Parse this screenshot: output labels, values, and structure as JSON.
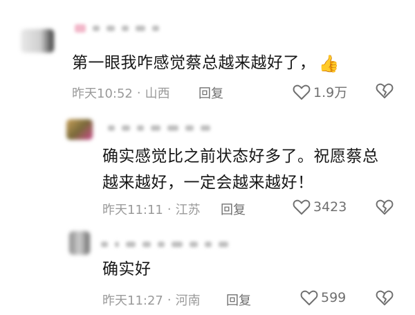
{
  "comments": [
    {
      "text": "第一眼我咋感觉蔡总越来越好了，",
      "emoji": "👍",
      "time": "昨天10:52",
      "location": "山西",
      "reply_label": "回复",
      "likes": "1.9万"
    },
    {
      "text": "确实感觉比之前状态好多了。祝愿蔡总越来越好，一定会越来越好！",
      "line1": "确实感觉比之前状态好多了。祝愿蔡总",
      "line2": "越来越好，一定会越来越好！",
      "time": "昨天11:11",
      "location": "江苏",
      "reply_label": "回复",
      "likes": "3423"
    },
    {
      "text": "确实好",
      "time": "昨天11:27",
      "location": "河南",
      "reply_label": "回复",
      "likes": "599"
    }
  ],
  "separator": "·",
  "icons": {
    "like": "heart-outline-icon",
    "dislike": "broken-heart-icon",
    "emoji": "thumbs-up-emoji"
  },
  "colors": {
    "text": "#171717",
    "meta": "#9a9a9a",
    "icon": "#6f6f6f"
  }
}
